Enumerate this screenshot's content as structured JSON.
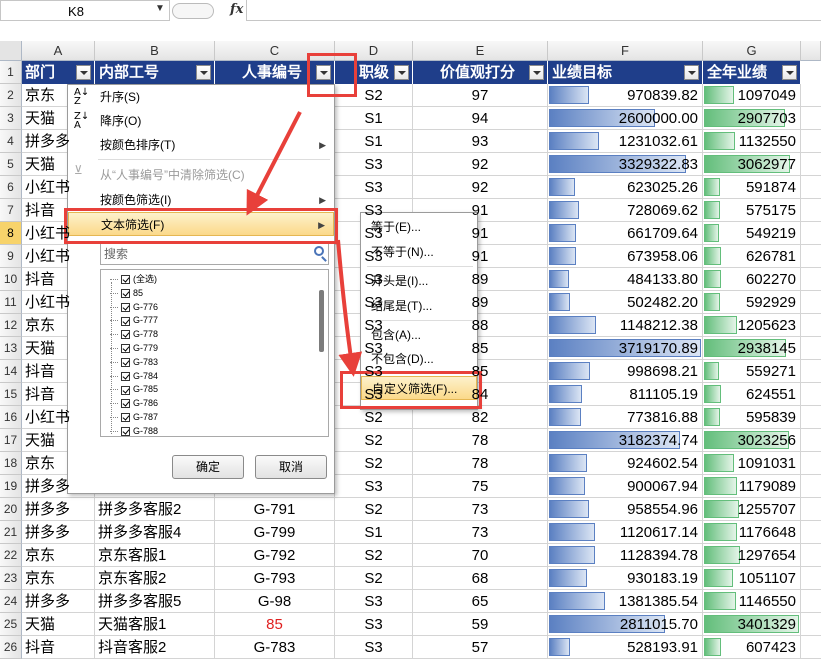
{
  "formula_bar": {
    "name_box": "K8",
    "fx_label": "fx",
    "formula": ""
  },
  "columns": [
    "A",
    "B",
    "C",
    "D",
    "E",
    "F",
    "G"
  ],
  "row_numbers": [
    "1",
    "2",
    "3",
    "4",
    "5",
    "6",
    "7",
    "8",
    "9",
    "10",
    "11",
    "12",
    "13",
    "14",
    "15",
    "16",
    "17",
    "18",
    "19",
    "20",
    "21",
    "22",
    "23",
    "24",
    "25",
    "26"
  ],
  "selected_row": "8",
  "headers": {
    "dept": "部门",
    "staff_id": "内部工号",
    "hr_no": "人事编号",
    "level": "职级",
    "value_score": "价值观打分",
    "target": "业绩目标",
    "annual": "全年业绩"
  },
  "rows": [
    {
      "dept": "京东",
      "staff": "",
      "hr": "",
      "level": "S2",
      "score": "97",
      "target": "970839.82",
      "annual": "1097049",
      "target_frac": 0.26,
      "annual_frac": 0.32
    },
    {
      "dept": "天猫",
      "staff": "",
      "hr": "",
      "level": "S1",
      "score": "94",
      "target": "2600000.00",
      "annual": "2907703",
      "target_frac": 0.7,
      "annual_frac": 0.85
    },
    {
      "dept": "拼多多",
      "staff": "",
      "hr": "",
      "level": "S1",
      "score": "93",
      "target": "1231032.61",
      "annual": "1132550",
      "target_frac": 0.33,
      "annual_frac": 0.33
    },
    {
      "dept": "天猫",
      "staff": "",
      "hr": "",
      "level": "S3",
      "score": "92",
      "target": "3329322.83",
      "annual": "3062977",
      "target_frac": 0.9,
      "annual_frac": 0.9
    },
    {
      "dept": "小红书",
      "staff": "",
      "hr": "",
      "level": "S3",
      "score": "92",
      "target": "623025.26",
      "annual": "591874",
      "target_frac": 0.17,
      "annual_frac": 0.17
    },
    {
      "dept": "抖音",
      "staff": "",
      "hr": "",
      "level": "S3",
      "score": "91",
      "target": "728069.62",
      "annual": "575175",
      "target_frac": 0.2,
      "annual_frac": 0.17
    },
    {
      "dept": "小红书",
      "staff": "",
      "hr": "",
      "level": "S3",
      "score": "91",
      "target": "661709.64",
      "annual": "549219",
      "target_frac": 0.18,
      "annual_frac": 0.16
    },
    {
      "dept": "小红书",
      "staff": "",
      "hr": "",
      "level": "S3",
      "score": "91",
      "target": "673958.06",
      "annual": "626781",
      "target_frac": 0.18,
      "annual_frac": 0.18
    },
    {
      "dept": "抖音",
      "staff": "",
      "hr": "",
      "level": "S3",
      "score": "89",
      "target": "484133.80",
      "annual": "602270",
      "target_frac": 0.13,
      "annual_frac": 0.18
    },
    {
      "dept": "小红书",
      "staff": "",
      "hr": "",
      "level": "S3",
      "score": "89",
      "target": "502482.20",
      "annual": "592929",
      "target_frac": 0.14,
      "annual_frac": 0.17
    },
    {
      "dept": "京东",
      "staff": "",
      "hr": "",
      "level": "S3",
      "score": "88",
      "target": "1148212.38",
      "annual": "1205623",
      "target_frac": 0.31,
      "annual_frac": 0.35
    },
    {
      "dept": "天猫",
      "staff": "",
      "hr": "",
      "level": "S3",
      "score": "85",
      "target": "3719170.89",
      "annual": "2938145",
      "target_frac": 1.0,
      "annual_frac": 0.86
    },
    {
      "dept": "抖音",
      "staff": "",
      "hr": "",
      "level": "S3",
      "score": "85",
      "target": "998698.21",
      "annual": "559271",
      "target_frac": 0.27,
      "annual_frac": 0.16
    },
    {
      "dept": "抖音",
      "staff": "",
      "hr": "",
      "level": "S3",
      "score": "84",
      "target": "811105.19",
      "annual": "624551",
      "target_frac": 0.22,
      "annual_frac": 0.18
    },
    {
      "dept": "小红书",
      "staff": "",
      "hr": "",
      "level": "S2",
      "score": "82",
      "target": "773816.88",
      "annual": "595839",
      "target_frac": 0.21,
      "annual_frac": 0.17
    },
    {
      "dept": "天猫",
      "staff": "",
      "hr": "",
      "level": "S2",
      "score": "78",
      "target": "3182374.74",
      "annual": "3023256",
      "target_frac": 0.86,
      "annual_frac": 0.89
    },
    {
      "dept": "京东",
      "staff": "",
      "hr": "",
      "level": "S2",
      "score": "78",
      "target": "924602.54",
      "annual": "1091031",
      "target_frac": 0.25,
      "annual_frac": 0.32
    },
    {
      "dept": "拼多多",
      "staff": "",
      "hr": "",
      "level": "S3",
      "score": "75",
      "target": "900067.94",
      "annual": "1179089",
      "target_frac": 0.24,
      "annual_frac": 0.35
    },
    {
      "dept": "拼多多",
      "staff": "拼多多客服2",
      "hr": "G-791",
      "level": "S2",
      "score": "73",
      "target": "958554.96",
      "annual": "1255707",
      "target_frac": 0.26,
      "annual_frac": 0.37
    },
    {
      "dept": "拼多多",
      "staff": "拼多多客服4",
      "hr": "G-799",
      "level": "S1",
      "score": "73",
      "target": "1120617.14",
      "annual": "1176648",
      "target_frac": 0.3,
      "annual_frac": 0.35
    },
    {
      "dept": "京东",
      "staff": "京东客服1",
      "hr": "G-792",
      "level": "S2",
      "score": "70",
      "target": "1128394.78",
      "annual": "1297654",
      "target_frac": 0.3,
      "annual_frac": 0.38
    },
    {
      "dept": "京东",
      "staff": "京东客服2",
      "hr": "G-793",
      "level": "S2",
      "score": "68",
      "target": "930183.19",
      "annual": "1051107",
      "target_frac": 0.25,
      "annual_frac": 0.31
    },
    {
      "dept": "拼多多",
      "staff": "拼多多客服5",
      "hr": "G-98",
      "level": "S3",
      "score": "65",
      "target": "1381385.54",
      "annual": "1146550",
      "target_frac": 0.37,
      "annual_frac": 0.34
    },
    {
      "dept": "天猫",
      "staff": "天猫客服1",
      "hr": "85",
      "hr_red": true,
      "level": "S3",
      "score": "59",
      "target": "2811015.70",
      "annual": "3401329",
      "target_frac": 0.76,
      "annual_frac": 1.0
    },
    {
      "dept": "抖音",
      "staff": "抖音客服2",
      "hr": "G-783",
      "level": "S3",
      "score": "57",
      "target": "528193.91",
      "annual": "607423",
      "target_frac": 0.14,
      "annual_frac": 0.18
    }
  ],
  "filter_menu": {
    "sort_asc": "升序(S)",
    "sort_desc": "降序(O)",
    "sort_by_color": "按颜色排序(T)",
    "clear_filter": "从“人事编号”中清除筛选(C)",
    "filter_by_color": "按颜色筛选(I)",
    "text_filter": "文本筛选(F)",
    "search_placeholder": "搜索",
    "checklist": [
      "(全选)",
      "85",
      "G-776",
      "G-777",
      "G-778",
      "G-779",
      "G-783",
      "G-784",
      "G-785",
      "G-786",
      "G-787",
      "G-788"
    ],
    "ok": "确定",
    "cancel": "取消"
  },
  "text_filter_submenu": {
    "equals": "等于(E)...",
    "not_equals": "不等于(N)...",
    "begins_with": "开头是(I)...",
    "ends_with": "结尾是(T)...",
    "contains": "包含(A)...",
    "not_contains": "不包含(D)...",
    "custom": "自定义筛选(F)..."
  },
  "colors": {
    "header_bg": "#1f3e8a",
    "databar_blue": "#5b80c2",
    "databar_green": "#63be7b",
    "highlight_red": "#e8403a",
    "menu_highlight": "#fbd98a"
  }
}
